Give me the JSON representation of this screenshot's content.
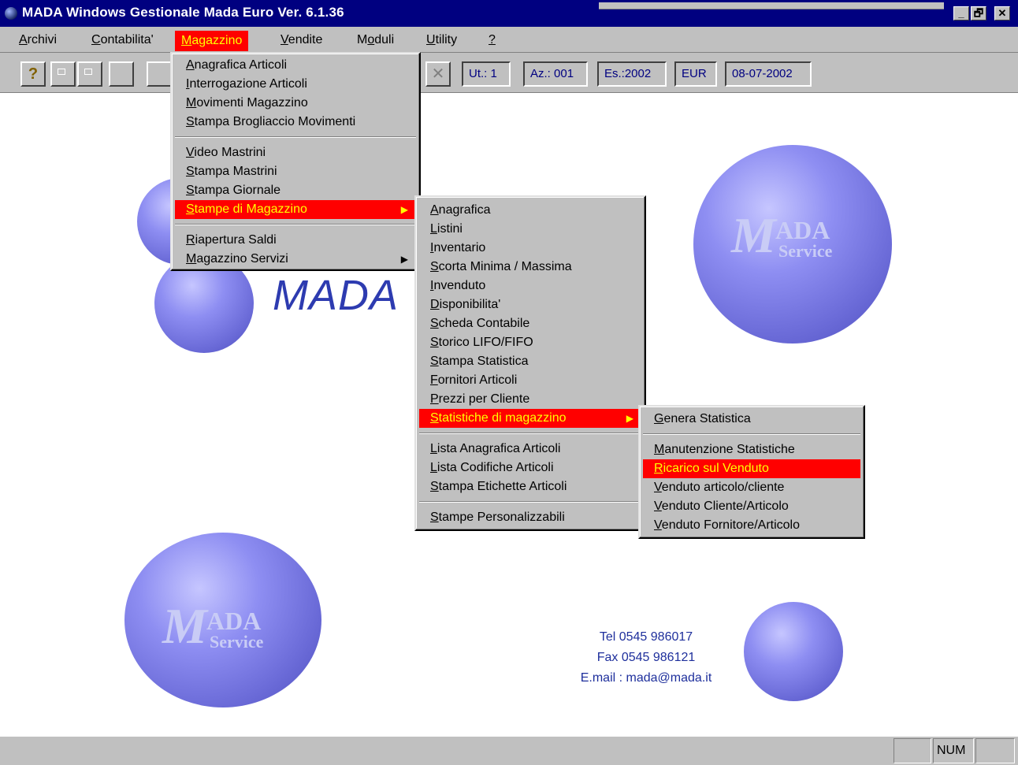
{
  "window": {
    "title": "MADA Windows Gestionale  Mada Euro Ver. 6.1.36",
    "controls": [
      "_",
      "🗗",
      "✕"
    ]
  },
  "menubar": [
    {
      "label": "Archivi",
      "u": "A",
      "rest": "rchivi"
    },
    {
      "label": "Contabilita'",
      "u": "C",
      "rest": "ontabilita'"
    },
    {
      "label": "Magazzino",
      "u": "M",
      "rest": "agazzino",
      "active": true
    },
    {
      "label": "Vendite",
      "u": "V",
      "rest": "endite"
    },
    {
      "label": "Moduli",
      "pre": "M",
      "u": "o",
      "rest": "duli"
    },
    {
      "label": "Utility",
      "u": "U",
      "rest": "tility"
    },
    {
      "label": "?",
      "u": "?",
      "rest": ""
    }
  ],
  "toolbar": {
    "help_icon": "?",
    "fields": [
      "Ut.: 1",
      "Az.: 001",
      "Es.:2002",
      "EUR",
      "08-07-2002"
    ]
  },
  "menu_magazzino": {
    "group1": [
      {
        "u": "A",
        "rest": "nagrafica Articoli"
      },
      {
        "u": "I",
        "rest": "nterrogazione Articoli"
      },
      {
        "u": "M",
        "rest": "ovimenti Magazzino"
      },
      {
        "u": "S",
        "rest": "tampa Brogliaccio Movimenti"
      }
    ],
    "group2": [
      {
        "u": "V",
        "rest": "ideo Mastrini"
      },
      {
        "u": "S",
        "rest": "tampa Mastrini"
      },
      {
        "u": "S",
        "rest": "tampa Giornale"
      },
      {
        "u": "S",
        "rest": "tampe di Magazzino"
      }
    ],
    "group3": [
      {
        "u": "R",
        "rest": "iapertura Saldi"
      },
      {
        "u": "M",
        "rest": "agazzino Servizi"
      }
    ]
  },
  "menu_stampe": {
    "group1": [
      {
        "u": "A",
        "rest": "nagrafica"
      },
      {
        "u": "L",
        "rest": "istini"
      },
      {
        "u": "I",
        "rest": "nventario"
      },
      {
        "u": "S",
        "rest": "corta Minima / Massima"
      },
      {
        "u": "I",
        "rest": "nvenduto"
      },
      {
        "u": "D",
        "rest": "isponibilita'"
      },
      {
        "u": "S",
        "rest": "cheda Contabile"
      },
      {
        "u": "S",
        "rest": "torico LIFO/FIFO"
      },
      {
        "u": "S",
        "rest": "tampa Statistica"
      },
      {
        "u": "F",
        "rest": "ornitori Articoli"
      },
      {
        "u": "P",
        "rest": "rezzi per Cliente"
      },
      {
        "u": "S",
        "rest": "tatistiche di magazzino"
      }
    ],
    "group2": [
      {
        "u": "L",
        "rest": "ista Anagrafica Articoli"
      },
      {
        "u": "L",
        "rest": "ista Codifiche Articoli"
      },
      {
        "u": "S",
        "rest": "tampa Etichette Articoli"
      }
    ],
    "group3": [
      {
        "u": "S",
        "rest": "tampe Personalizzabili"
      }
    ]
  },
  "menu_statistiche": {
    "group1": [
      {
        "u": "G",
        "rest": "enera Statistica"
      }
    ],
    "group2": [
      {
        "u": "M",
        "rest": "anutenzione Statistiche"
      },
      {
        "u": "R",
        "rest": "icarico sul Venduto"
      },
      {
        "u": "V",
        "rest": "enduto articolo/cliente"
      },
      {
        "u": "V",
        "rest": "enduto Cliente/Articolo"
      },
      {
        "u": "V",
        "rest": "enduto Fornitore/Articolo"
      }
    ]
  },
  "branding": {
    "mada_logo": "MADA",
    "sphere_big": "M",
    "sphere_ada": "ADA",
    "sphere_service": "Service"
  },
  "contact": {
    "tel": "Tel 0545 986017",
    "fax": "Fax 0545 986121",
    "email": "E.mail : mada@mada.it"
  },
  "statusbar": {
    "num": "NUM"
  },
  "colors": {
    "titlebar": "#000080",
    "highlight": "#ff0000",
    "highlight_text": "#ffff00",
    "sphere": "#7b7be0"
  }
}
